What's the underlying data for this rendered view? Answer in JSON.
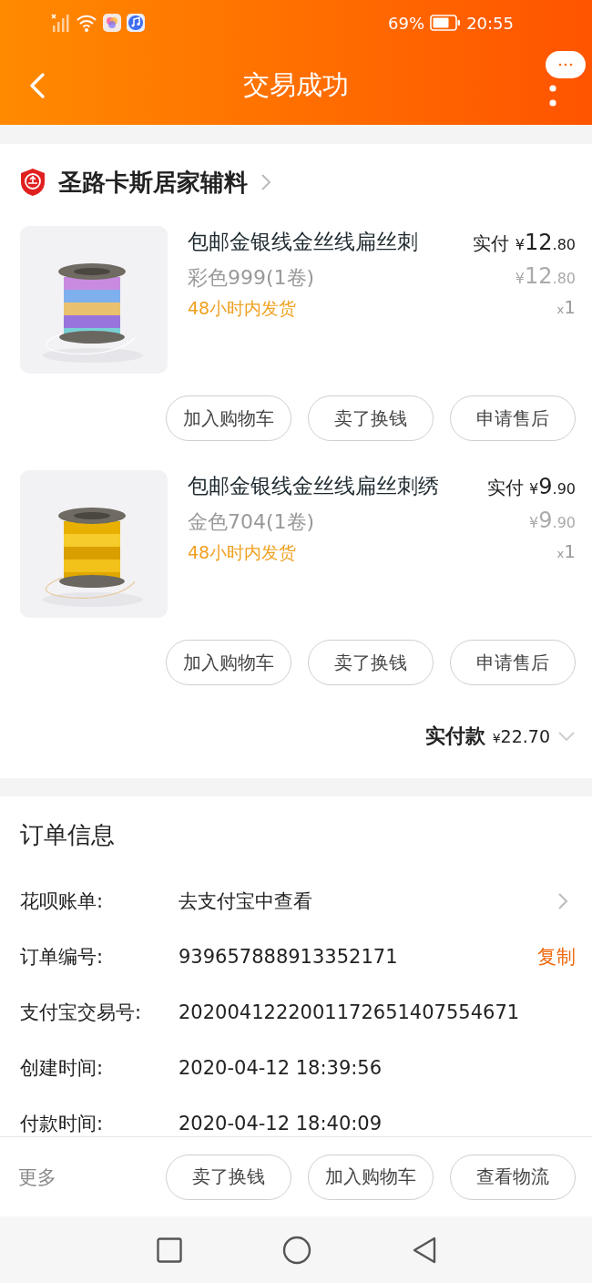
{
  "status_bar": {
    "battery": "69%",
    "time": "20:55"
  },
  "header": {
    "title": "交易成功"
  },
  "store": {
    "name": "圣路卡斯居家辅料",
    "items": [
      {
        "title": "包邮金银线金丝线扁丝刺",
        "variant": "彩色999(1卷)",
        "shipping": "48小时内发货",
        "paid_label": "实付",
        "paid": {
          "currency": "¥",
          "whole": "12",
          "fraction": ".80"
        },
        "price": {
          "currency": "¥",
          "whole": "12",
          "fraction": ".80"
        },
        "qty_mark": "x",
        "qty": "1",
        "buttons": [
          "加入购物车",
          "卖了换钱",
          "申请售后"
        ]
      },
      {
        "title": "包邮金银线金丝线扁丝刺绣",
        "variant": "金色704(1卷)",
        "shipping": "48小时内发货",
        "paid_label": "实付",
        "paid": {
          "currency": "¥",
          "whole": "9",
          "fraction": ".90"
        },
        "price": {
          "currency": "¥",
          "whole": "9",
          "fraction": ".90"
        },
        "qty_mark": "x",
        "qty": "1",
        "buttons": [
          "加入购物车",
          "卖了换钱",
          "申请售后"
        ]
      }
    ],
    "total": {
      "label": "实付款",
      "currency": "¥",
      "amount": "22.70"
    }
  },
  "order_info": {
    "title": "订单信息",
    "rows": [
      {
        "label": "花呗账单:",
        "value": "去支付宝中查看",
        "kind": "link"
      },
      {
        "label": "订单编号:",
        "value": "939657888913352171",
        "kind": "copy",
        "action": "复制"
      },
      {
        "label": "支付宝交易号:",
        "value": "2020041222001172651407554671",
        "kind": "plain"
      },
      {
        "label": "创建时间:",
        "value": "2020-04-12 18:39:56",
        "kind": "plain"
      },
      {
        "label": "付款时间:",
        "value": "2020-04-12 18:40:09",
        "kind": "plain"
      }
    ]
  },
  "bottom_bar": {
    "more": "更多",
    "buttons": [
      "卖了换钱",
      "加入购物车",
      "查看物流"
    ]
  }
}
